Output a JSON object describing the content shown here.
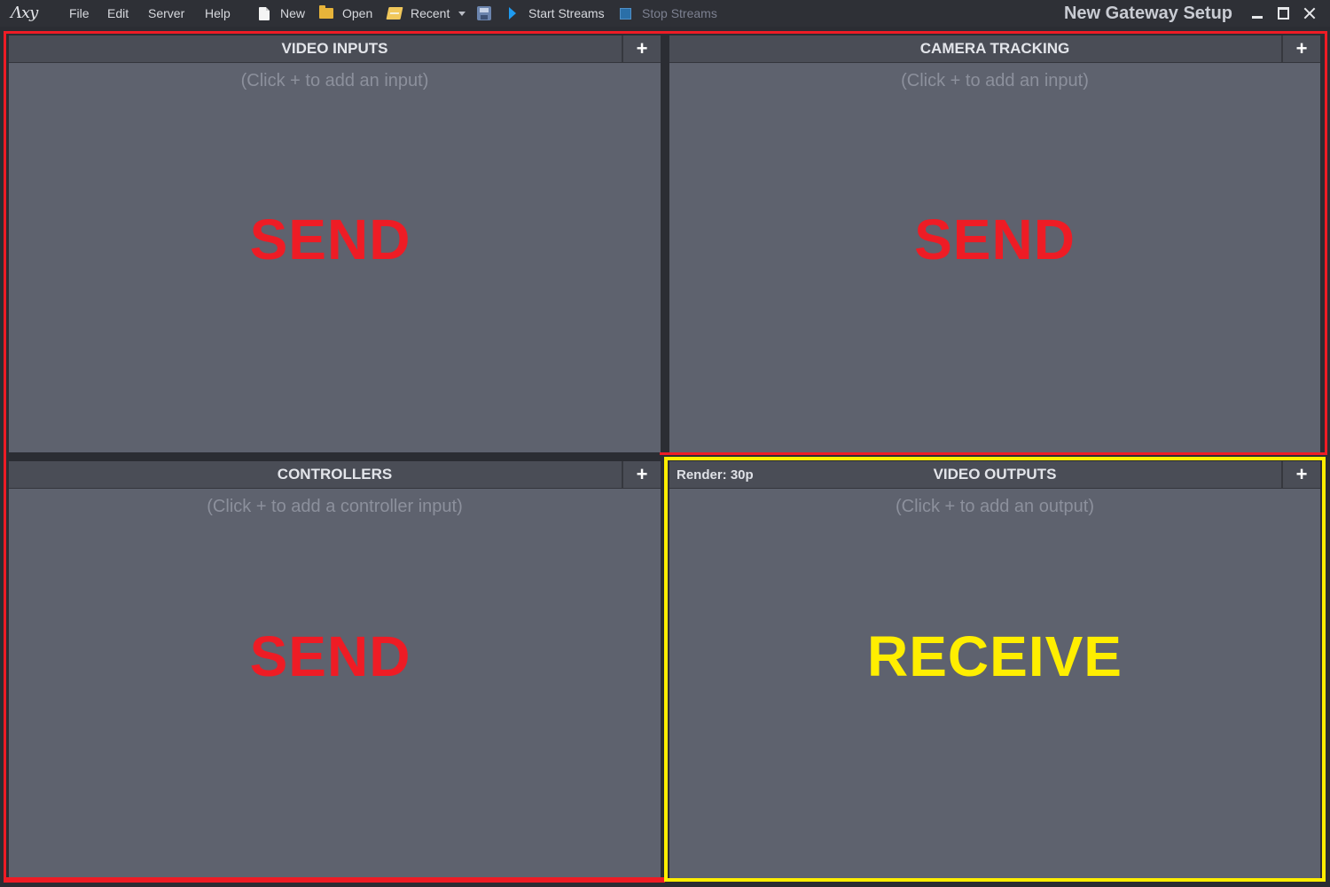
{
  "app": {
    "logo_text": "Λxy",
    "window_title": "New Gateway Setup"
  },
  "menu": {
    "items": [
      {
        "label": "File"
      },
      {
        "label": "Edit"
      },
      {
        "label": "Server"
      },
      {
        "label": "Help"
      }
    ]
  },
  "toolbar": {
    "new_label": "New",
    "open_label": "Open",
    "recent_label": "Recent",
    "start_streams_label": "Start Streams",
    "stop_streams_label": "Stop Streams"
  },
  "panels": {
    "video_inputs": {
      "title": "VIDEO INPUTS",
      "add": "+",
      "hint": "(Click + to add an input)",
      "overlay": "SEND"
    },
    "camera_tracking": {
      "title": "CAMERA TRACKING",
      "add": "+",
      "hint": "(Click + to add an input)",
      "overlay": "SEND"
    },
    "controllers": {
      "title": "CONTROLLERS",
      "add": "+",
      "hint": "(Click + to add a controller input)",
      "overlay": "SEND"
    },
    "video_outputs": {
      "title": "VIDEO OUTPUTS",
      "add": "+",
      "render": "Render: 30p",
      "hint": "(Click + to add an output)",
      "overlay": "RECEIVE"
    }
  },
  "colors": {
    "send": "#ee1c25",
    "receive": "#ffee00",
    "panel_bg": "#5e626e",
    "header_bg": "#4a4d56"
  }
}
